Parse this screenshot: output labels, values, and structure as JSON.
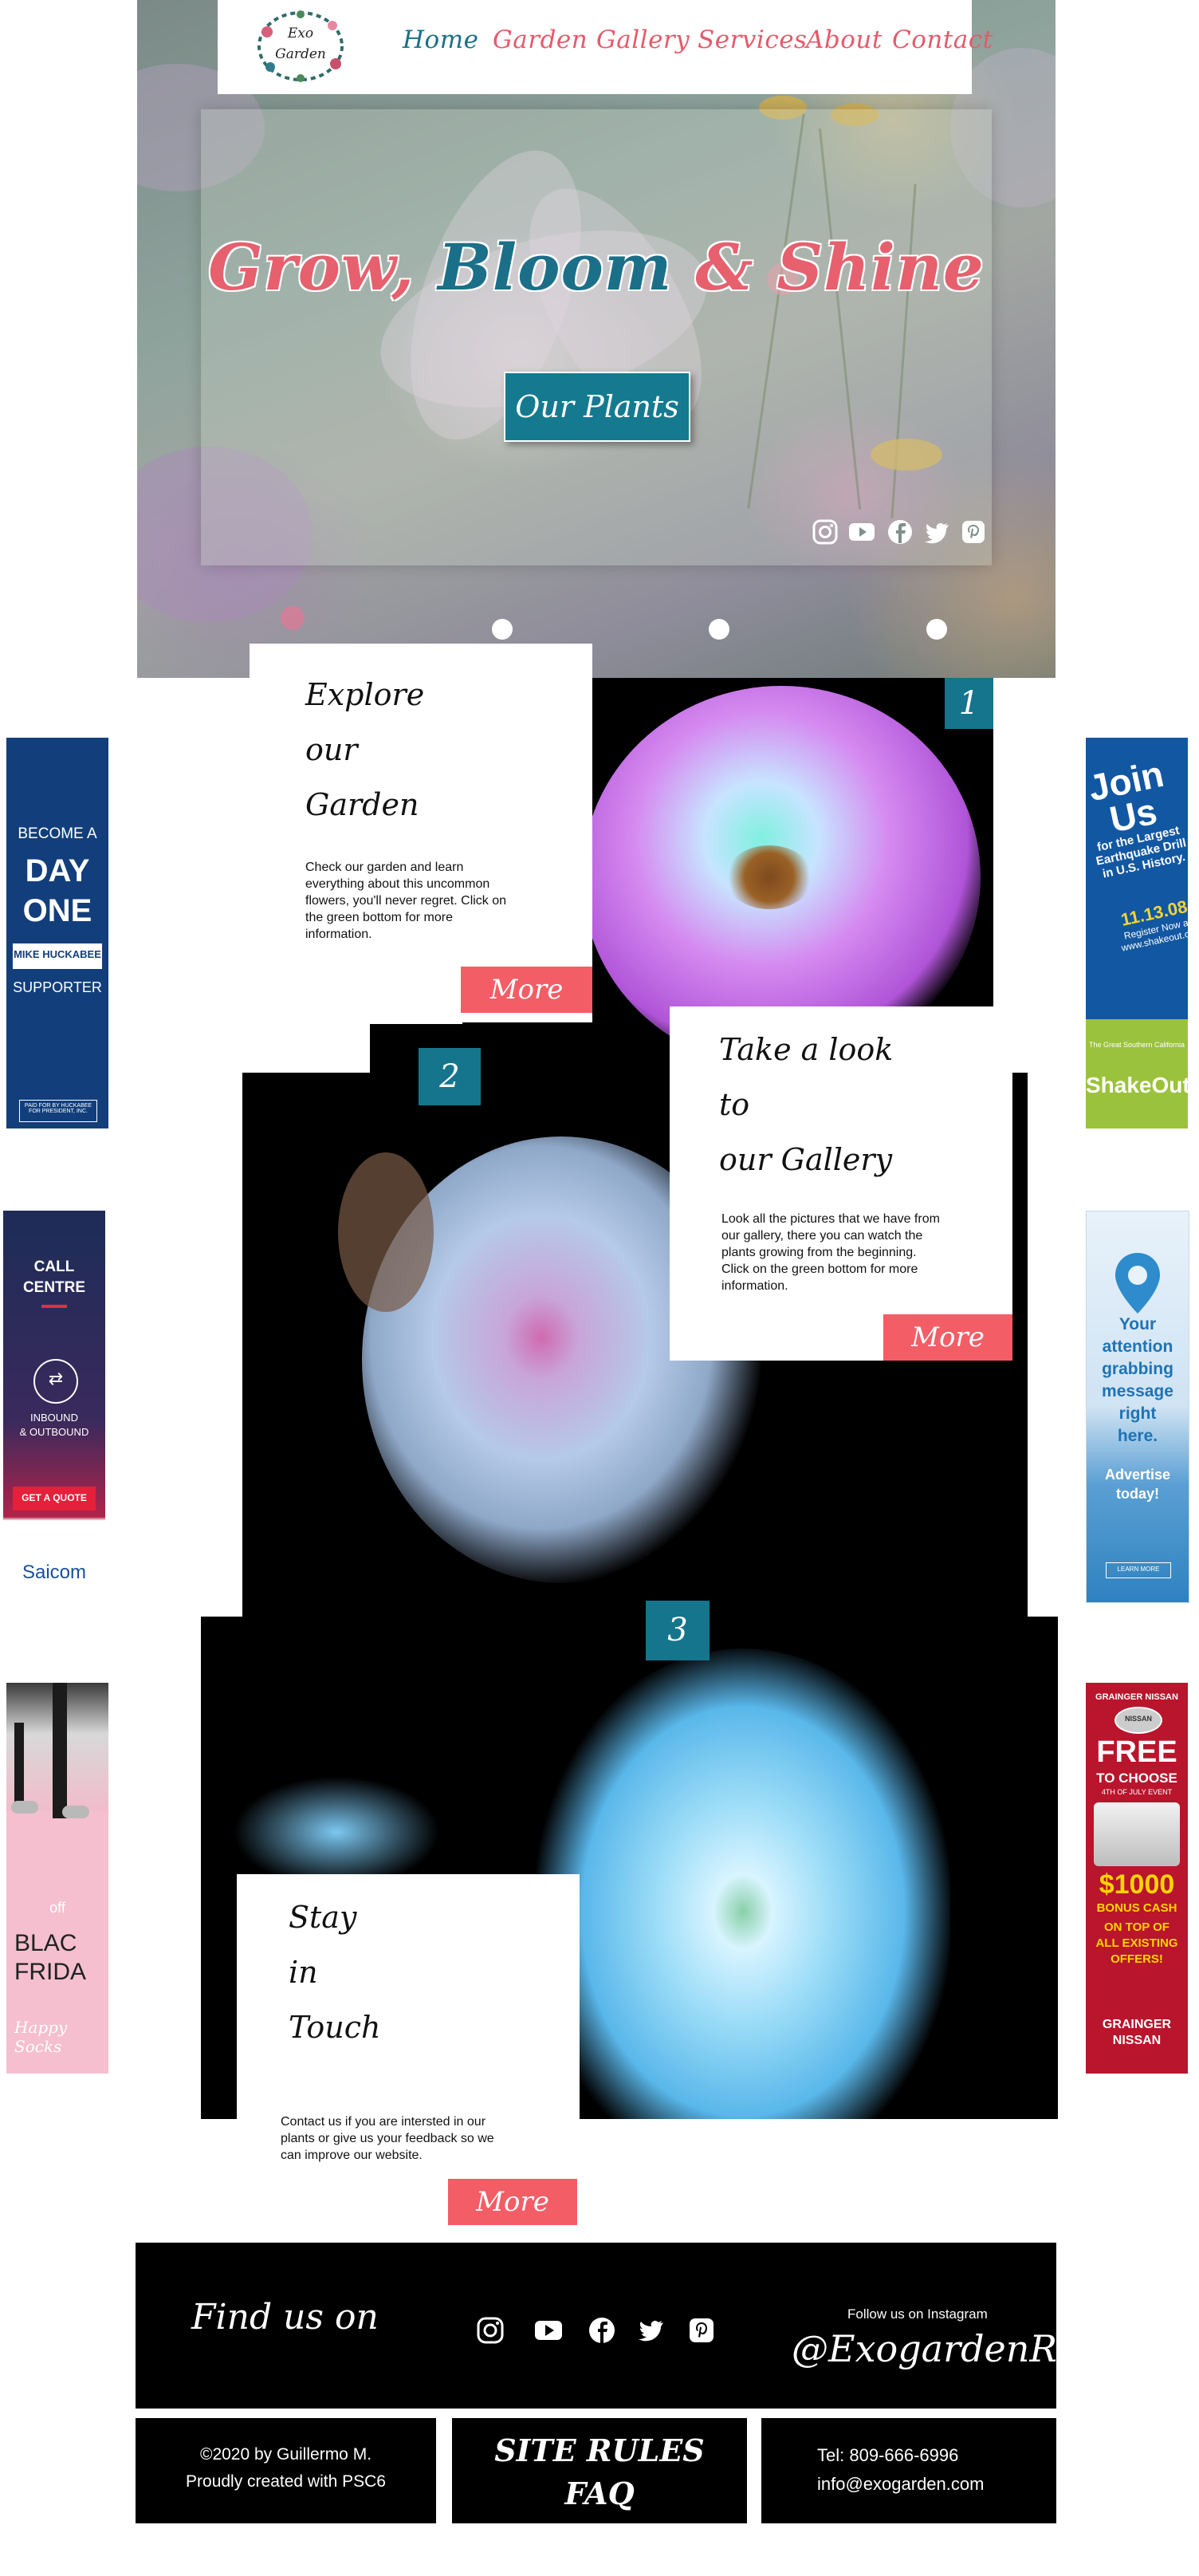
{
  "colors": {
    "teal": "#15758c",
    "coral": "#f35d66",
    "black": "#000000"
  },
  "nav": {
    "logo_line1": "Exo",
    "logo_line2": "Garden",
    "items": [
      "Home",
      "Garden",
      "Gallery",
      "Services",
      "About",
      "Contact"
    ],
    "active": "Home"
  },
  "hero": {
    "title_part1": "Grow,",
    "title_part2": "Bloom",
    "title_part3": "&",
    "title_part4": "Shine",
    "button_label": "Our Plants",
    "social_icons": [
      "instagram-icon",
      "youtube-icon",
      "facebook-icon",
      "twitter-icon",
      "pinterest-icon"
    ],
    "slides": 3
  },
  "sections": [
    {
      "number": "1",
      "title_lines": [
        "Explore",
        "our",
        "Garden"
      ],
      "body": "Check our garden and learn everything about this uncommon flowers, you'll never regret. Click on the green bottom for more information.",
      "more_label": "More"
    },
    {
      "number": "2",
      "title_lines": [
        "Take a look",
        "to",
        "our Gallery"
      ],
      "body": "Look all the pictures that we have from our gallery, there you can watch the plants growing from the beginning. Click on the green bottom for more information.",
      "more_label": "More"
    },
    {
      "number": "3",
      "title_lines": [
        "Stay",
        "in",
        "Touch"
      ],
      "body": "Contact us if you are intersted in our plants or give us your feedback so we can improve our website.",
      "more_label": "More"
    }
  ],
  "ads": {
    "left1": {
      "line1": "BECOME A",
      "line2": "DAY",
      "line3": "ONE",
      "brand": "MIKE HUCKABEE",
      "line4": "SUPPORTER",
      "fine": "PAID FOR BY HUCKABEE FOR PRESIDENT, INC."
    },
    "left2": {
      "line1": "CALL",
      "line2": "CENTRE",
      "line3": "INBOUND",
      "line4": "& OUTBOUND",
      "cta": "GET A QUOTE",
      "brand": "Saicom"
    },
    "left3": {
      "line1": "off",
      "line2": "BLAC",
      "line3": "FRIDA",
      "brand": "Happy Socks"
    },
    "right1": {
      "line1": "Join",
      "line2": "Us",
      "line3": "for the Largest",
      "line4": "Earthquake Drill",
      "line5": "in U.S. History.",
      "date": "11.13.08",
      "line6": "Register Now at",
      "line7": "www.shakeout.org",
      "line8": "The Great Southern California",
      "brand": "ShakeOut"
    },
    "right2": {
      "line1": "Your",
      "line2": "attention",
      "line3": "grabbing",
      "line4": "message",
      "line5": "right",
      "line6": "here.",
      "line7": "Advertise",
      "line8": "today!",
      "cta": "LEARN MORE"
    },
    "right3": {
      "top": "GRAINGER NISSAN",
      "badge": "NISSAN",
      "line1": "FREE",
      "line2": "TO CHOOSE",
      "line3": "4TH OF JULY EVENT",
      "line4": "$1000",
      "line5": "BONUS CASH",
      "line6": "ON TOP OF",
      "line7": "ALL EXISTING",
      "line8": "OFFERS!",
      "line9": "GRAINGER",
      "line10": "NISSAN"
    }
  },
  "footer": {
    "find_us": "Find us on",
    "social_icons": [
      "instagram-icon",
      "youtube-icon",
      "facebook-icon",
      "twitter-icon",
      "pinterest-icon"
    ],
    "follow_label": "Follow us on Instagram",
    "handle": "@ExogardenRD",
    "copyright_line1": "©2020 by Guillermo M.",
    "copyright_line2": "Proudly created with PSC6",
    "rules_line1": "SITE RULES",
    "rules_line2": "FAQ",
    "tel": "Tel: 809-666-6996",
    "email": "info@exogarden.com"
  }
}
